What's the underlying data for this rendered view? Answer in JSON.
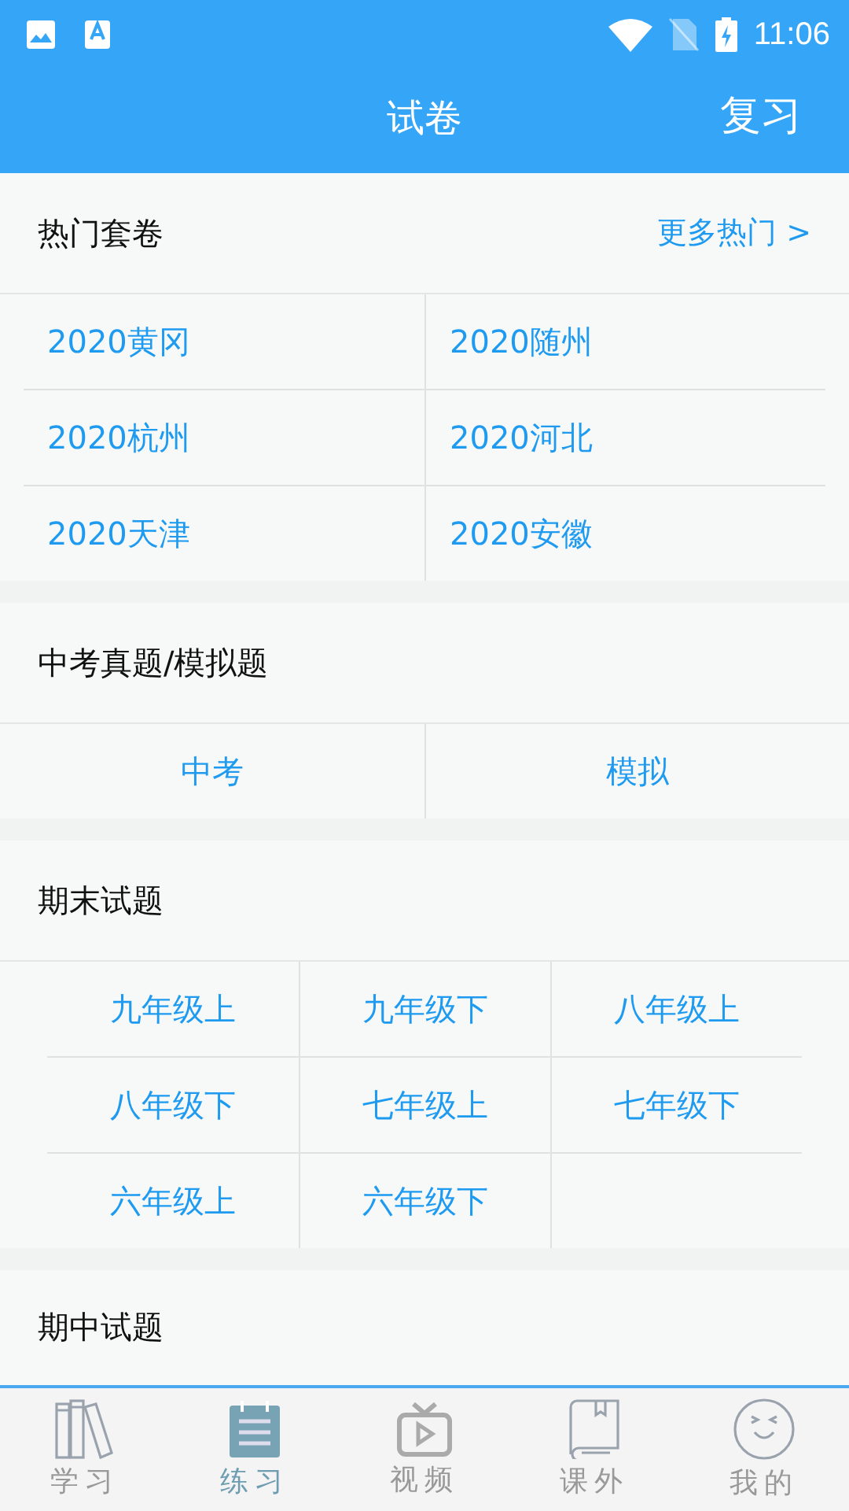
{
  "status_bar": {
    "time": "11:06"
  },
  "header": {
    "title": "试卷",
    "action": "复习"
  },
  "sections": [
    {
      "title": "热门套卷",
      "more": "更多热门 >",
      "kind": "two-left",
      "items": [
        "2020黄冈",
        "2020随州",
        "2020杭州",
        "2020河北",
        "2020天津",
        "2020安徽"
      ]
    },
    {
      "title": "中考真题/模拟题",
      "kind": "two-center",
      "items": [
        "中考",
        "模拟"
      ]
    },
    {
      "title": "期末试题",
      "kind": "three-center",
      "items": [
        "九年级上",
        "九年级下",
        "八年级上",
        "八年级下",
        "七年级上",
        "七年级下",
        "六年级上",
        "六年级下"
      ]
    },
    {
      "title": "期中试题",
      "kind": "title-only"
    }
  ],
  "tabs": [
    {
      "label": "学习",
      "kind": "books",
      "selected": false
    },
    {
      "label": "练习",
      "kind": "notepad",
      "selected": true
    },
    {
      "label": "视频",
      "kind": "tv",
      "selected": false
    },
    {
      "label": "课外",
      "kind": "book",
      "selected": false
    },
    {
      "label": "我的",
      "kind": "face",
      "selected": false
    }
  ]
}
